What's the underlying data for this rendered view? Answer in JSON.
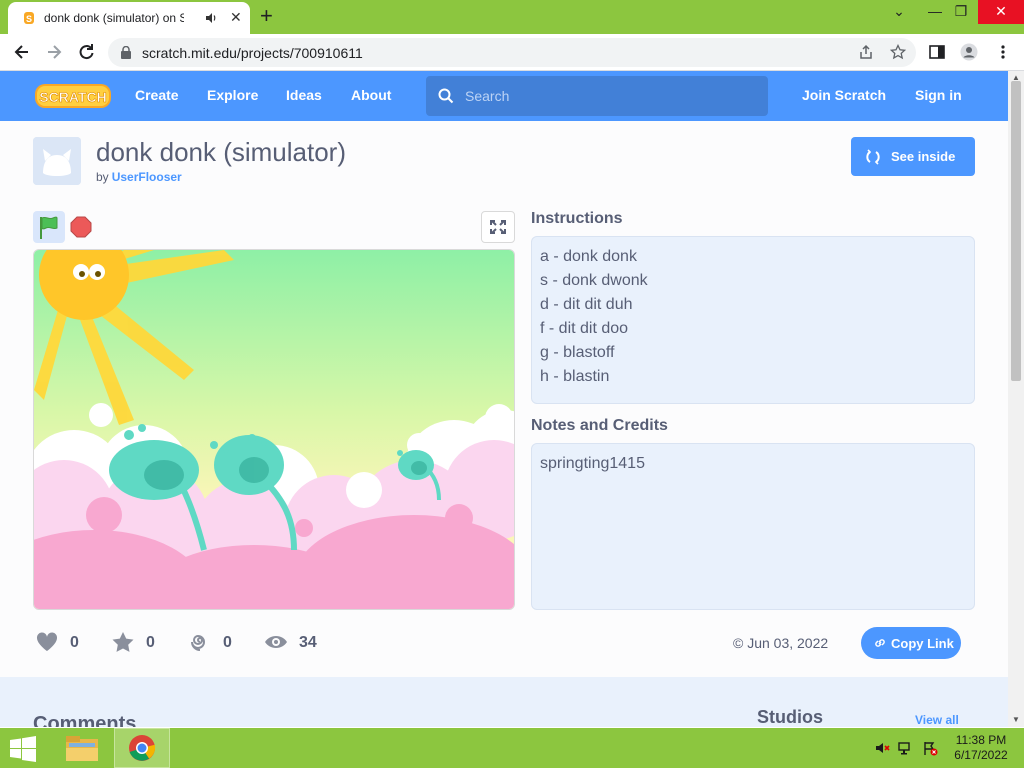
{
  "browser": {
    "tab_title": "donk donk (simulator) on Scratch",
    "url": "scratch.mit.edu/projects/700910611",
    "new_tab": "+",
    "tab_close": "✕",
    "window_controls": {
      "minimize": "—",
      "restore": "❐",
      "close": "✕",
      "dropdown": "⌄"
    }
  },
  "scratch_nav": {
    "logo_text": "SCRATCH",
    "links": [
      "Create",
      "Explore",
      "Ideas",
      "About"
    ],
    "search_placeholder": "Search",
    "join": "Join Scratch",
    "sign_in": "Sign in"
  },
  "project": {
    "title": "donk donk (simulator)",
    "by_label": "by",
    "author": "UserFlooser",
    "see_inside": "See inside",
    "instructions_heading": "Instructions",
    "instructions": [
      "a - donk donk",
      "s - donk dwonk",
      "d - dit dit duh",
      "f - dit dit doo",
      "g - blastoff",
      "h - blastin"
    ],
    "notes_heading": "Notes and Credits",
    "notes": "springting1415",
    "stats": {
      "loves": "0",
      "favorites": "0",
      "remixes": "0",
      "views": "34"
    },
    "date": "© Jun 03, 2022",
    "copy_link": "Copy Link"
  },
  "lower": {
    "comments_heading": "Comments",
    "studios_heading": "Studios",
    "view_all": "View all"
  },
  "taskbar": {
    "time": "11:38 PM",
    "date": "6/17/2022"
  },
  "colors": {
    "scratch_blue": "#4c97ff",
    "taskbar_green": "#8cc63f",
    "text": "#575e75"
  }
}
